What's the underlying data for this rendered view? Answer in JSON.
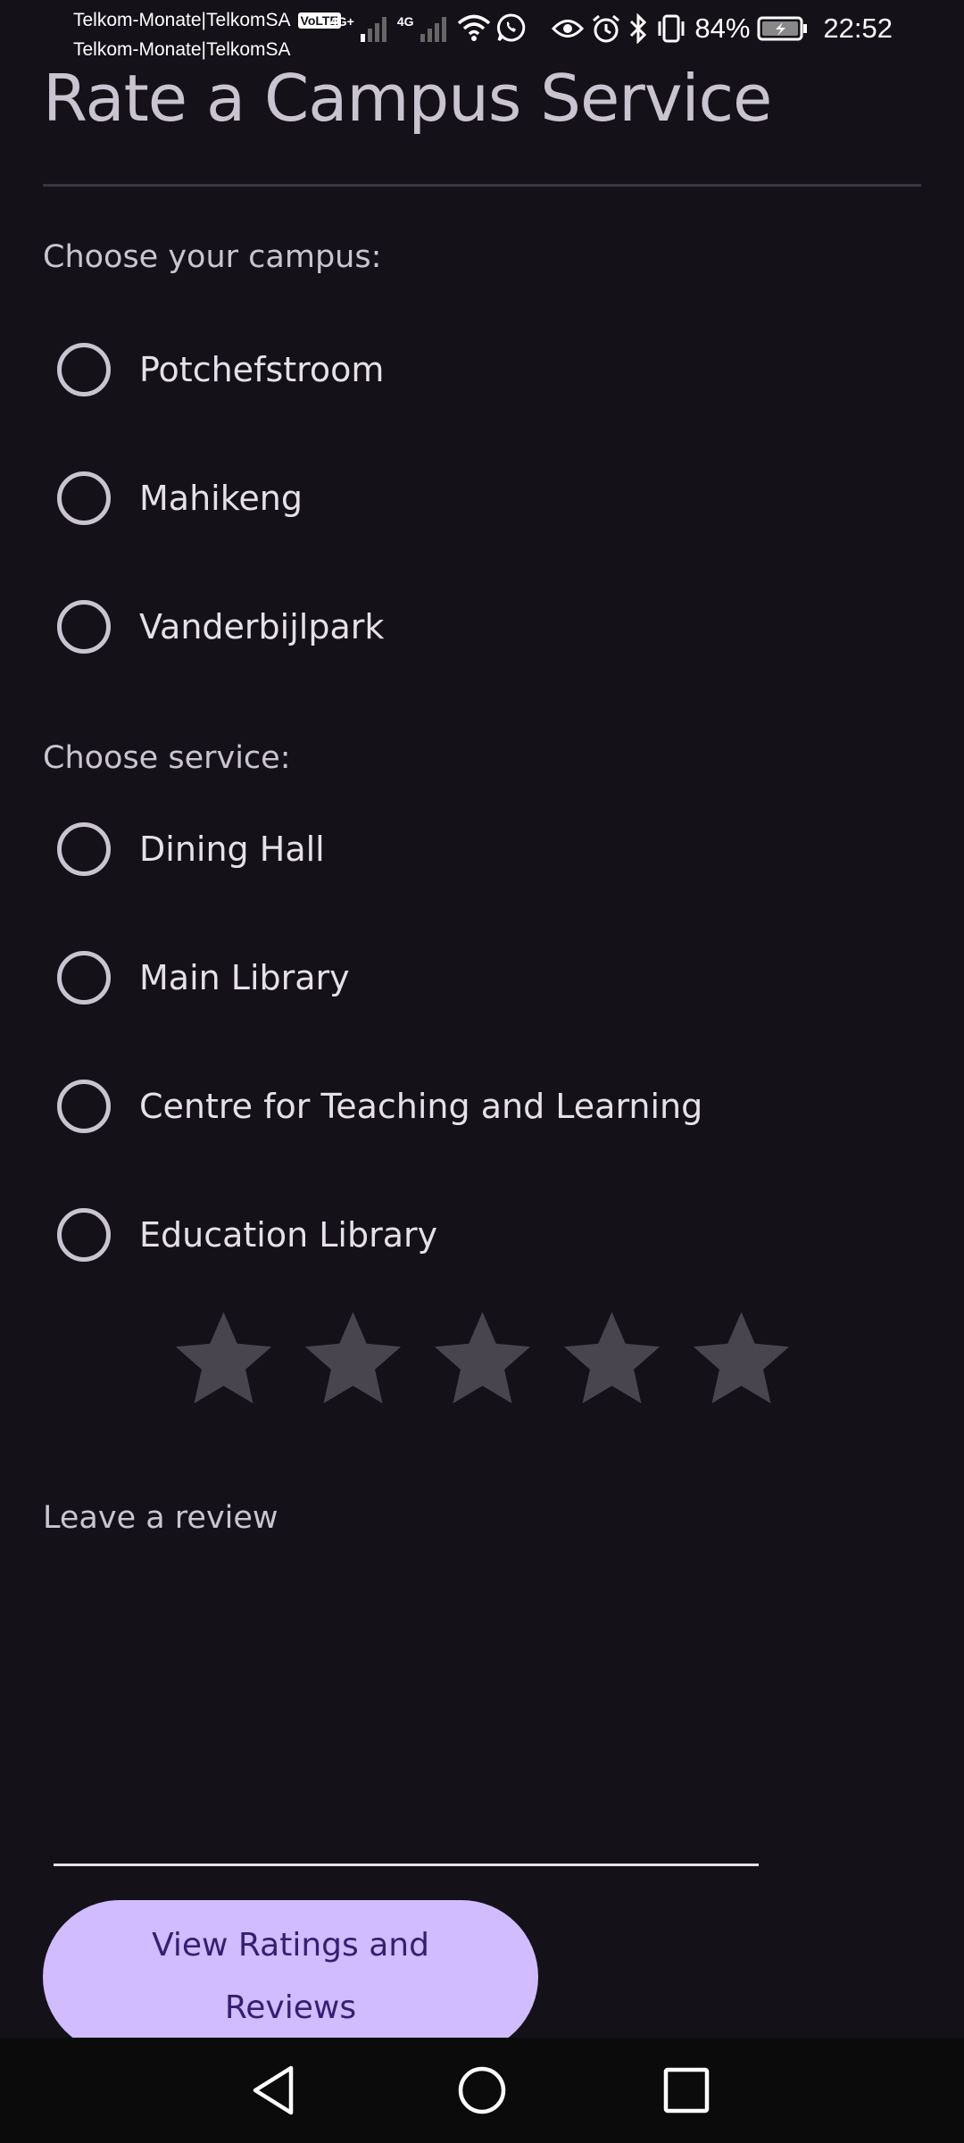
{
  "status_bar": {
    "carrier_line_1": "Telkom-Monate|TelkomSA",
    "carrier_line_2": "Telkom-Monate|TelkomSA",
    "volte_badge": "VoLTE",
    "network_1": "4G+",
    "network_2": "4G",
    "battery": "84%",
    "time": "22:52"
  },
  "header": {
    "title": "Rate a Campus Service"
  },
  "campus_section": {
    "label": "Choose your campus:",
    "options": [
      "Potchefstroom",
      "Mahikeng",
      "Vanderbijlpark"
    ]
  },
  "service_section": {
    "label": "Choose service:",
    "options": [
      "Dining Hall",
      "Main Library",
      "Centre for Teaching and Learning",
      "Education Library"
    ]
  },
  "rating": {
    "value": 0,
    "max": 5,
    "star_color": "#48454e"
  },
  "review": {
    "label": "Leave a review",
    "value": ""
  },
  "actions": {
    "view_ratings_label": "View Ratings and Reviews"
  },
  "colors": {
    "background": "#141218",
    "accent": "#d0bcff",
    "on_accent": "#381e72"
  },
  "nav": {
    "icons": [
      "back-icon",
      "home-icon",
      "recents-icon"
    ]
  }
}
